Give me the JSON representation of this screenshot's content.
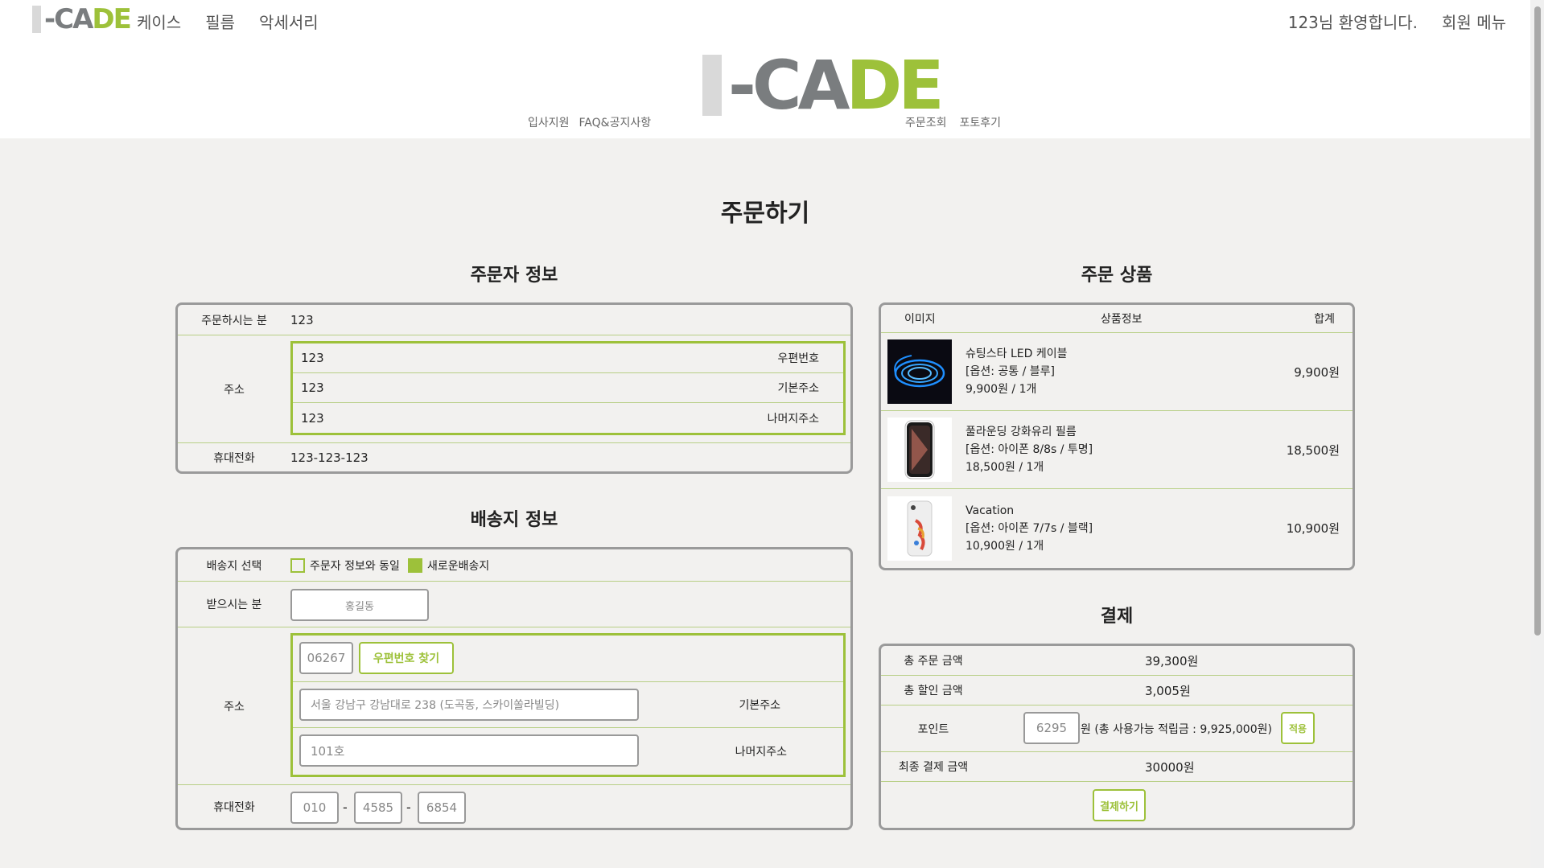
{
  "header": {
    "nav": [
      "케이스",
      "필름",
      "악세서리"
    ],
    "welcome": "123님 환영합니다.",
    "member_menu": "회원 메뉴",
    "sub_left": [
      "입사지원",
      "FAQ&공지사항"
    ],
    "sub_right": [
      "주문조회",
      "포토후기"
    ],
    "logo": {
      "i": "I",
      "dash": "-",
      "ca": "CA",
      "de": "DE"
    }
  },
  "page_title": "주문하기",
  "orderer": {
    "title": "주문자 정보",
    "name_label": "주문하시는 분",
    "name": "123",
    "address_label": "주소",
    "address": [
      {
        "value": "123",
        "label": "우편번호"
      },
      {
        "value": "123",
        "label": "기본주소"
      },
      {
        "value": "123",
        "label": "나머지주소"
      }
    ],
    "phone_label": "휴대전화",
    "phone": "123-123-123"
  },
  "shipping": {
    "title": "배송지 정보",
    "select_label": "배송지 선택",
    "option_same": "주문자 정보와 동일",
    "option_new": "새로운배송지",
    "receiver_label": "받으시는 분",
    "receiver_placeholder": "홍길동",
    "address_label": "주소",
    "zip_placeholder": "06267",
    "zip_button": "우편번호 찾기",
    "addr1_placeholder": "서울 강남구 강남대로 238 (도곡동, 스카이쏠라빌딩)",
    "addr1_label": "기본주소",
    "addr2_placeholder": "101호",
    "addr2_label": "나머지주소",
    "phone_label": "휴대전화",
    "phone1": "010",
    "phone2": "4585",
    "phone3": "6854",
    "dash": "-"
  },
  "products": {
    "title": "주문 상품",
    "headers": {
      "image": "이미지",
      "info": "상품정보",
      "total": "합계"
    },
    "items": [
      {
        "name": "슈팅스타 LED 케이블",
        "option": "[옵션: 공통 / 블루]",
        "price": "9,900원 / 1개",
        "total": "9,900원"
      },
      {
        "name": "풀라운딩 강화유리 필름",
        "option": "[옵션: 아이폰 8/8s / 투명]",
        "price": "18,500원 / 1개",
        "total": "18,500원"
      },
      {
        "name": "Vacation",
        "option": "[옵션: 아이폰 7/7s / 블랙]",
        "price": "10,900원 / 1개",
        "total": "10,900원"
      }
    ]
  },
  "payment": {
    "title": "결제",
    "total_label": "총 주문 금액",
    "total": "39,300원",
    "discount_label": "총 할인 금액",
    "discount": "3,005원",
    "point_label": "포인트",
    "point_value": "6295",
    "point_note": "원 (총 사용가능 적립금 : 9,925,000원)",
    "apply_button": "적용",
    "final_label": "최종 결제 금액",
    "final": "30000원",
    "pay_button": "결제하기"
  },
  "colors": {
    "accent": "#9dc13a",
    "logo_gray": "#7a7d7f",
    "background": "#f2f1ef"
  }
}
